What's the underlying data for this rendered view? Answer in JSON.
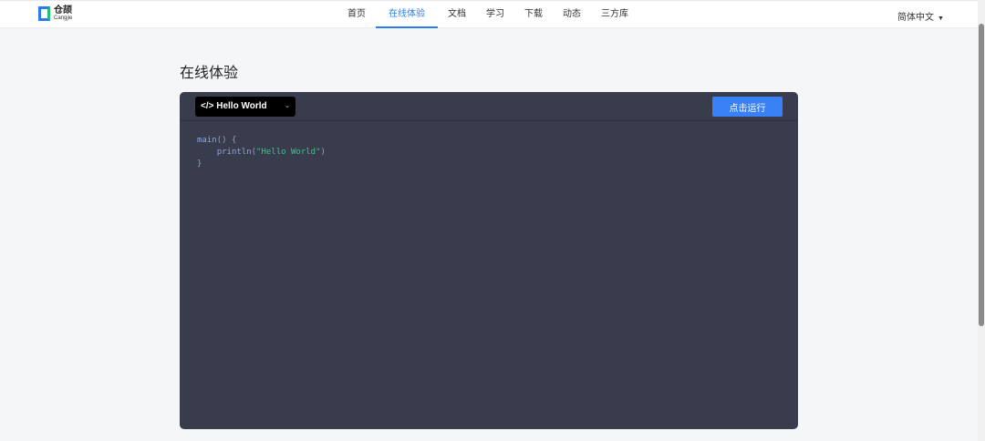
{
  "nav": {
    "logo_cn": "仓颉",
    "logo_en": "Cangjie",
    "items": [
      "首页",
      "在线体验",
      "文档",
      "学习",
      "下载",
      "动态",
      "三方库"
    ],
    "active_index": 1,
    "language": "简体中文"
  },
  "page": {
    "title": "在线体验"
  },
  "editor": {
    "example": "</> Hello World",
    "run_label": "点击运行",
    "code": {
      "l1_fn": "main",
      "l1_rest": "() {",
      "l2_fn": "println",
      "l2_open": "(",
      "l2_str": "\"Hello World\"",
      "l2_close": ")",
      "l3": "}"
    }
  },
  "colors": {
    "accent": "#2a7bf4",
    "editor_bg": "#383c4d"
  }
}
